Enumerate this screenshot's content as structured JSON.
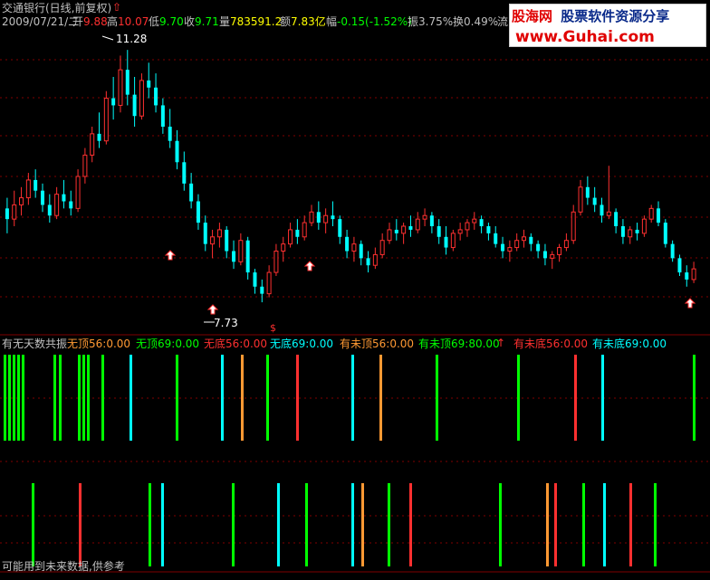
{
  "header": {
    "title": "交通银行(日线,前复权)",
    "date": "2009/07/21/二",
    "open_label": "开",
    "open_value": "9.88",
    "high_label": "高",
    "high_value": "10.07",
    "low_label": "低",
    "low_value": "9.70",
    "close_label": "收",
    "close_value": "9.71",
    "volume_label": "量",
    "volume_value": "783591.2",
    "amount_label": "额",
    "amount_value": "7.83亿",
    "change_label": "幅",
    "change_value": "-0.15(-1.52%)",
    "amplitude_label": "振",
    "amplitude_value": "3.75%",
    "turnover_label": "换",
    "turnover_value": "0.49%",
    "flow_label": "流"
  },
  "watermark": {
    "logo": "股海网",
    "tagline": "股票软件资源分享",
    "url": "www.Guhai.com"
  },
  "price_labels": {
    "high": "11.28",
    "low": "7.73"
  },
  "indicator": {
    "name": "有无天数共振",
    "items": [
      {
        "text": "无顶56:0.00",
        "color": "#ff9933"
      },
      {
        "text": "无顶69:0.00",
        "color": "#00ff00"
      },
      {
        "text": "无底56:0.00",
        "color": "#ff3030"
      },
      {
        "text": "无底69:0.00",
        "color": "#00ffff"
      },
      {
        "text": "有未顶56:0.00",
        "color": "#ff9933"
      },
      {
        "text": "有未顶69:80.00",
        "color": "#00ff00"
      },
      {
        "text": "有未底56:0.00",
        "color": "#ff3030"
      },
      {
        "text": "有未底69:0.00",
        "color": "#00ffff"
      }
    ],
    "footer_note": "可能用到未来数据,供参考"
  },
  "colors": {
    "up": "#ff3030",
    "down": "#00ffff",
    "signal_green": "#00ff00",
    "signal_orange": "#ff9933",
    "signal_red": "#ff3030",
    "signal_cyan": "#00ffff",
    "grid": "#800000"
  },
  "chart_data": {
    "type": "candlestick",
    "ylim": [
      7.4,
      11.6
    ],
    "candles": [
      {
        "o": 9.05,
        "h": 9.2,
        "l": 8.7,
        "c": 8.9
      },
      {
        "o": 8.9,
        "h": 9.3,
        "l": 8.8,
        "c": 9.1
      },
      {
        "o": 9.1,
        "h": 9.35,
        "l": 8.95,
        "c": 9.2
      },
      {
        "o": 9.2,
        "h": 9.55,
        "l": 9.1,
        "c": 9.45
      },
      {
        "o": 9.45,
        "h": 9.6,
        "l": 9.2,
        "c": 9.3
      },
      {
        "o": 9.3,
        "h": 9.4,
        "l": 9.0,
        "c": 9.1
      },
      {
        "o": 9.1,
        "h": 9.25,
        "l": 8.85,
        "c": 8.95
      },
      {
        "o": 8.95,
        "h": 9.35,
        "l": 8.9,
        "c": 9.25
      },
      {
        "o": 9.25,
        "h": 9.45,
        "l": 9.05,
        "c": 9.15
      },
      {
        "o": 9.15,
        "h": 9.3,
        "l": 8.95,
        "c": 9.05
      },
      {
        "o": 9.05,
        "h": 9.6,
        "l": 9.0,
        "c": 9.5
      },
      {
        "o": 9.5,
        "h": 9.9,
        "l": 9.4,
        "c": 9.8
      },
      {
        "o": 9.8,
        "h": 10.2,
        "l": 9.7,
        "c": 10.1
      },
      {
        "o": 10.1,
        "h": 10.4,
        "l": 9.9,
        "c": 10.0
      },
      {
        "o": 10.0,
        "h": 10.7,
        "l": 9.95,
        "c": 10.6
      },
      {
        "o": 10.6,
        "h": 10.9,
        "l": 10.3,
        "c": 10.5
      },
      {
        "o": 10.5,
        "h": 11.2,
        "l": 10.4,
        "c": 11.0
      },
      {
        "o": 11.0,
        "h": 11.28,
        "l": 10.5,
        "c": 10.65
      },
      {
        "o": 10.65,
        "h": 10.9,
        "l": 10.2,
        "c": 10.35
      },
      {
        "o": 10.35,
        "h": 10.95,
        "l": 10.3,
        "c": 10.85
      },
      {
        "o": 10.85,
        "h": 11.1,
        "l": 10.6,
        "c": 10.75
      },
      {
        "o": 10.75,
        "h": 10.95,
        "l": 10.4,
        "c": 10.5
      },
      {
        "o": 10.5,
        "h": 10.6,
        "l": 10.1,
        "c": 10.2
      },
      {
        "o": 10.2,
        "h": 10.45,
        "l": 9.9,
        "c": 10.0
      },
      {
        "o": 10.0,
        "h": 10.15,
        "l": 9.6,
        "c": 9.7
      },
      {
        "o": 9.7,
        "h": 9.85,
        "l": 9.3,
        "c": 9.4
      },
      {
        "o": 9.4,
        "h": 9.55,
        "l": 9.05,
        "c": 9.15
      },
      {
        "o": 9.15,
        "h": 9.25,
        "l": 8.75,
        "c": 8.85
      },
      {
        "o": 8.85,
        "h": 8.95,
        "l": 8.45,
        "c": 8.55
      },
      {
        "o": 8.55,
        "h": 8.75,
        "l": 8.35,
        "c": 8.65
      },
      {
        "o": 8.65,
        "h": 8.85,
        "l": 8.5,
        "c": 8.75
      },
      {
        "o": 8.75,
        "h": 8.8,
        "l": 8.35,
        "c": 8.45
      },
      {
        "o": 8.45,
        "h": 8.6,
        "l": 8.2,
        "c": 8.3
      },
      {
        "o": 8.3,
        "h": 8.7,
        "l": 8.25,
        "c": 8.6
      },
      {
        "o": 8.6,
        "h": 8.65,
        "l": 8.05,
        "c": 8.15
      },
      {
        "o": 8.15,
        "h": 8.2,
        "l": 7.85,
        "c": 7.95
      },
      {
        "o": 7.95,
        "h": 8.05,
        "l": 7.73,
        "c": 7.85
      },
      {
        "o": 7.85,
        "h": 8.25,
        "l": 7.8,
        "c": 8.15
      },
      {
        "o": 8.15,
        "h": 8.55,
        "l": 8.1,
        "c": 8.45
      },
      {
        "o": 8.45,
        "h": 8.65,
        "l": 8.3,
        "c": 8.55
      },
      {
        "o": 8.55,
        "h": 8.85,
        "l": 8.5,
        "c": 8.75
      },
      {
        "o": 8.75,
        "h": 8.9,
        "l": 8.55,
        "c": 8.65
      },
      {
        "o": 8.65,
        "h": 8.95,
        "l": 8.6,
        "c": 8.85
      },
      {
        "o": 8.85,
        "h": 9.1,
        "l": 8.8,
        "c": 9.0
      },
      {
        "o": 9.0,
        "h": 9.15,
        "l": 8.75,
        "c": 8.85
      },
      {
        "o": 8.85,
        "h": 9.05,
        "l": 8.7,
        "c": 8.95
      },
      {
        "o": 8.95,
        "h": 9.15,
        "l": 8.8,
        "c": 8.9
      },
      {
        "o": 8.9,
        "h": 8.95,
        "l": 8.55,
        "c": 8.65
      },
      {
        "o": 8.65,
        "h": 8.75,
        "l": 8.35,
        "c": 8.45
      },
      {
        "o": 8.45,
        "h": 8.65,
        "l": 8.3,
        "c": 8.55
      },
      {
        "o": 8.55,
        "h": 8.6,
        "l": 8.25,
        "c": 8.35
      },
      {
        "o": 8.35,
        "h": 8.45,
        "l": 8.15,
        "c": 8.25
      },
      {
        "o": 8.25,
        "h": 8.5,
        "l": 8.2,
        "c": 8.4
      },
      {
        "o": 8.4,
        "h": 8.7,
        "l": 8.35,
        "c": 8.6
      },
      {
        "o": 8.6,
        "h": 8.85,
        "l": 8.55,
        "c": 8.75
      },
      {
        "o": 8.75,
        "h": 8.9,
        "l": 8.6,
        "c": 8.7
      },
      {
        "o": 8.7,
        "h": 8.85,
        "l": 8.55,
        "c": 8.8
      },
      {
        "o": 8.8,
        "h": 8.95,
        "l": 8.65,
        "c": 8.75
      },
      {
        "o": 8.75,
        "h": 9.0,
        "l": 8.7,
        "c": 8.9
      },
      {
        "o": 8.9,
        "h": 9.05,
        "l": 8.8,
        "c": 8.95
      },
      {
        "o": 8.95,
        "h": 9.0,
        "l": 8.7,
        "c": 8.8
      },
      {
        "o": 8.8,
        "h": 8.9,
        "l": 8.55,
        "c": 8.65
      },
      {
        "o": 8.65,
        "h": 8.8,
        "l": 8.4,
        "c": 8.5
      },
      {
        "o": 8.5,
        "h": 8.75,
        "l": 8.45,
        "c": 8.7
      },
      {
        "o": 8.7,
        "h": 8.85,
        "l": 8.6,
        "c": 8.75
      },
      {
        "o": 8.75,
        "h": 8.9,
        "l": 8.65,
        "c": 8.85
      },
      {
        "o": 8.85,
        "h": 9.0,
        "l": 8.75,
        "c": 8.9
      },
      {
        "o": 8.9,
        "h": 8.95,
        "l": 8.7,
        "c": 8.8
      },
      {
        "o": 8.8,
        "h": 8.85,
        "l": 8.6,
        "c": 8.7
      },
      {
        "o": 8.7,
        "h": 8.8,
        "l": 8.5,
        "c": 8.55
      },
      {
        "o": 8.55,
        "h": 8.65,
        "l": 8.35,
        "c": 8.45
      },
      {
        "o": 8.45,
        "h": 8.6,
        "l": 8.3,
        "c": 8.5
      },
      {
        "o": 8.5,
        "h": 8.7,
        "l": 8.45,
        "c": 8.6
      },
      {
        "o": 8.6,
        "h": 8.75,
        "l": 8.5,
        "c": 8.65
      },
      {
        "o": 8.65,
        "h": 8.7,
        "l": 8.45,
        "c": 8.55
      },
      {
        "o": 8.55,
        "h": 8.6,
        "l": 8.35,
        "c": 8.45
      },
      {
        "o": 8.45,
        "h": 8.55,
        "l": 8.25,
        "c": 8.35
      },
      {
        "o": 8.35,
        "h": 8.45,
        "l": 8.2,
        "c": 8.4
      },
      {
        "o": 8.4,
        "h": 8.55,
        "l": 8.3,
        "c": 8.5
      },
      {
        "o": 8.5,
        "h": 8.7,
        "l": 8.45,
        "c": 8.6
      },
      {
        "o": 8.6,
        "h": 9.1,
        "l": 8.55,
        "c": 9.0
      },
      {
        "o": 9.0,
        "h": 9.45,
        "l": 8.95,
        "c": 9.35
      },
      {
        "o": 9.35,
        "h": 9.5,
        "l": 9.1,
        "c": 9.2
      },
      {
        "o": 9.2,
        "h": 9.35,
        "l": 9.0,
        "c": 9.1
      },
      {
        "o": 9.1,
        "h": 9.2,
        "l": 8.85,
        "c": 8.95
      },
      {
        "o": 8.95,
        "h": 9.65,
        "l": 8.9,
        "c": 9.0
      },
      {
        "o": 9.0,
        "h": 9.05,
        "l": 8.7,
        "c": 8.8
      },
      {
        "o": 8.8,
        "h": 8.9,
        "l": 8.55,
        "c": 8.65
      },
      {
        "o": 8.65,
        "h": 8.8,
        "l": 8.55,
        "c": 8.75
      },
      {
        "o": 8.75,
        "h": 8.85,
        "l": 8.6,
        "c": 8.7
      },
      {
        "o": 8.7,
        "h": 8.95,
        "l": 8.65,
        "c": 8.9
      },
      {
        "o": 8.9,
        "h": 9.1,
        "l": 8.85,
        "c": 9.05
      },
      {
        "o": 9.05,
        "h": 9.15,
        "l": 8.8,
        "c": 8.85
      },
      {
        "o": 8.85,
        "h": 8.9,
        "l": 8.5,
        "c": 8.55
      },
      {
        "o": 8.55,
        "h": 8.6,
        "l": 8.3,
        "c": 8.35
      },
      {
        "o": 8.35,
        "h": 8.4,
        "l": 8.1,
        "c": 8.15
      },
      {
        "o": 8.15,
        "h": 8.25,
        "l": 7.95,
        "c": 8.05
      },
      {
        "o": 8.05,
        "h": 8.3,
        "l": 8.0,
        "c": 8.2
      }
    ],
    "signal_markers": [
      "11.28",
      "7.73"
    ],
    "panels": [
      "price",
      "indicator-top",
      "indicator-bottom"
    ]
  }
}
